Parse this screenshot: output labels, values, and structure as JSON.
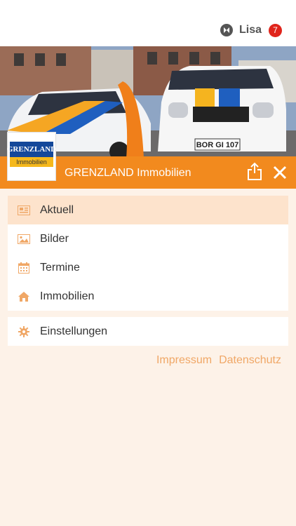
{
  "user": {
    "name": "Lisa",
    "notifications": "7"
  },
  "header": {
    "logo_top": "GRENZLAND",
    "logo_bottom": "Immobilien",
    "title": "GRENZLAND Immobilien",
    "plate": "BOR GI 107",
    "accent": "#f28a1e"
  },
  "menu": {
    "items": [
      {
        "label": "Aktuell",
        "icon": "news-icon",
        "active": true
      },
      {
        "label": "Bilder",
        "icon": "image-icon"
      },
      {
        "label": "Termine",
        "icon": "calendar-icon"
      },
      {
        "label": "Immobilien",
        "icon": "home-icon"
      }
    ],
    "settings": {
      "label": "Einstellungen",
      "icon": "gear-icon"
    }
  },
  "footer": {
    "impressum": "Impressum",
    "datenschutz": "Datenschutz"
  }
}
